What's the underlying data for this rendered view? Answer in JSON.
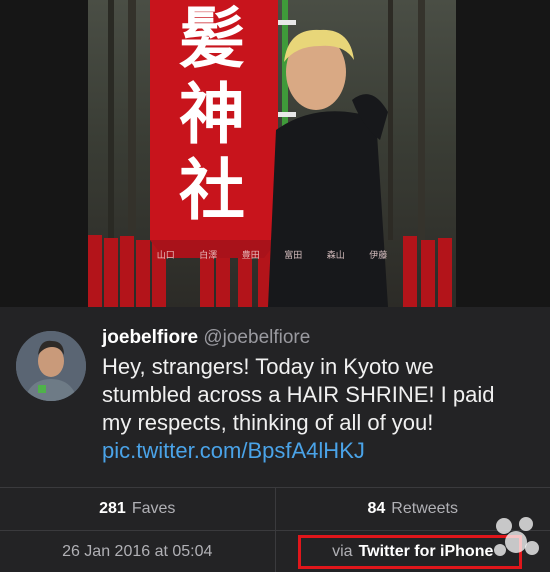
{
  "photo": {
    "banner_text": "髪神社",
    "plaque_text": "山口 白澤 豊田 富田 森山 伊藤"
  },
  "tweet": {
    "display_name": "joebelfiore",
    "handle": "@joebelfiore",
    "text": "Hey, strangers! Today in Kyoto we stumbled across a HAIR SHRINE! I paid my respects, thinking of all of you! ",
    "link": "pic.twitter.com/BpsfA4lHKJ"
  },
  "stats": {
    "faves_count": "281",
    "faves_label": "Faves",
    "retweets_count": "84",
    "retweets_label": "Retweets"
  },
  "meta": {
    "timestamp": "26 Jan 2016 at 05:04",
    "via_prefix": "via",
    "via_app": "Twitter for iPhone"
  },
  "colors": {
    "background": "#232325",
    "link": "#4aa3e8",
    "highlight": "#e0161b"
  }
}
